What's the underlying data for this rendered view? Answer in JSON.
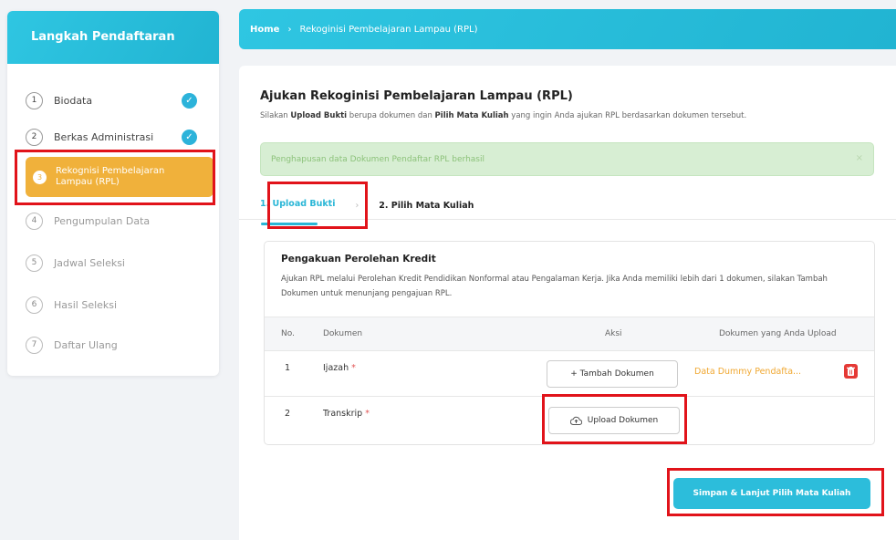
{
  "sidebar": {
    "title": "Langkah Pendaftaran",
    "steps": [
      {
        "num": "1",
        "label": "Biodata",
        "done": true
      },
      {
        "num": "2",
        "label": "Berkas Administrasi",
        "done": true
      },
      {
        "num": "3",
        "label": "Rekognisi Pembelajaran Lampau (RPL)",
        "active": true
      },
      {
        "num": "4",
        "label": "Pengumpulan Data"
      },
      {
        "num": "5",
        "label": "Jadwal Seleksi"
      },
      {
        "num": "6",
        "label": "Hasil Seleksi"
      },
      {
        "num": "7",
        "label": "Daftar Ulang"
      }
    ]
  },
  "breadcrumb": {
    "home": "Home",
    "separator": "›",
    "current": "Rekoginisi Pembelajaran Lampau (RPL)"
  },
  "main": {
    "title": "Ajukan Rekoginisi Pembelajaran Lampau (RPL)",
    "subtitle_pre": "Silakan ",
    "subtitle_b1": "Upload Bukti",
    "subtitle_mid": " berupa dokumen dan ",
    "subtitle_b2": "Pilih Mata Kuliah",
    "subtitle_post": " yang ingin Anda ajukan RPL berdasarkan dokumen tersebut.",
    "alert": "Penghapusan data Dokumen Pendaftar RPL berhasil",
    "alert_close": "×",
    "tab1": "1. Upload Bukti",
    "tab_separator": "›",
    "tab2": "2. Pilih Mata Kuliah"
  },
  "card": {
    "title": "Pengakuan Perolehan Kredit",
    "description": "Ajukan RPL melalui Perolehan Kredit Pendidikan Nonformal atau Pengalaman Kerja. Jika Anda memiliki lebih dari 1 dokumen, silakan Tambah Dokumen untuk menunjang pengajuan RPL.",
    "columns": [
      "No.",
      "Dokumen",
      "Aksi",
      "Dokumen yang Anda Upload"
    ],
    "rows": [
      {
        "no": "1",
        "doc": "Ijazah",
        "required": "*",
        "action": "+ Tambah Dokumen",
        "uploaded": "Data Dummy Pendafta..."
      },
      {
        "no": "2",
        "doc": "Transkrip",
        "required": "*",
        "action": "Upload Dokumen",
        "uploaded": ""
      }
    ]
  },
  "save_button": "Simpan & Lanjut Pilih Mata Kuliah",
  "colors": {
    "primary": "#2cbddb",
    "active_step": "#f0b13b",
    "highlight": "#e1131a",
    "success_bg": "#d7eed3",
    "danger": "#e53935"
  }
}
